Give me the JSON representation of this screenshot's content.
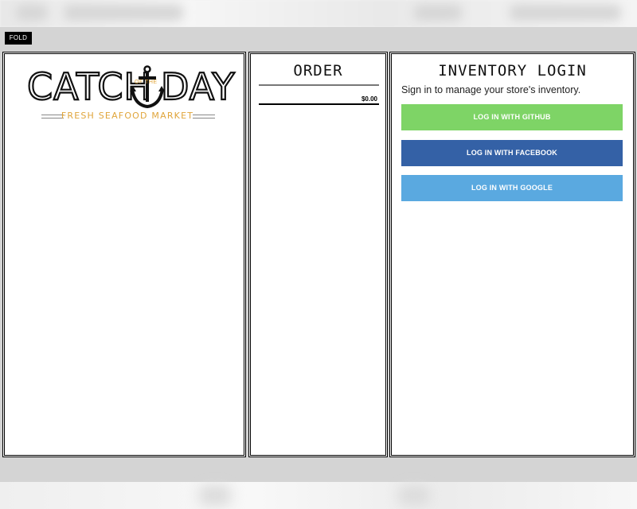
{
  "header": {
    "fold_label": "FOLD"
  },
  "menu": {
    "logo": {
      "word_left": "CATCH",
      "word_small": "OF THE",
      "word_right": "DAY",
      "tagline": "FRESH SEAFOOD MARKET"
    }
  },
  "order": {
    "title": "ORDER",
    "total": "$0.00"
  },
  "inventory": {
    "title": "INVENTORY LOGIN",
    "description": "Sign in to manage your store's inventory.",
    "buttons": [
      {
        "label": "LOG IN WITH GITHUB",
        "color": "#7ed466"
      },
      {
        "label": "LOG IN WITH FACEBOOK",
        "color": "#3461a6"
      },
      {
        "label": "LOG IN WITH GOOGLE",
        "color": "#5aa9e0"
      }
    ]
  },
  "colors": {
    "accent": "#e0a53b",
    "background": "#d4d4d4"
  }
}
